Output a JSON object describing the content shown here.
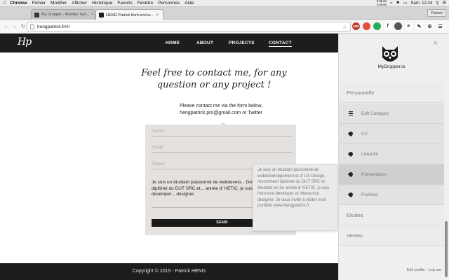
{
  "menubar": {
    "app": "Chrome",
    "items": [
      "Fichier",
      "Modifier",
      "Afficher",
      "Historique",
      "Favoris",
      "Fenêtre",
      "Personnes",
      "Aide"
    ],
    "net_up": "8.0Ko/s",
    "net_down": "0.5Ko/s",
    "clock": "Sam. 12:24"
  },
  "tabs": [
    {
      "title": "My Dropper - Modifier l'art..."
    },
    {
      "title": "HENG Patrick front-end w..."
    }
  ],
  "profile_label": "Patrick",
  "address": "hengpatrick.fr/#/",
  "site": {
    "logo": "Hp",
    "nav": [
      "HOME",
      "ABOUT",
      "PROJECTS",
      "CONTACT"
    ],
    "headline_line1": "Feel free to contact me, for any",
    "headline_line2": "question or any project !",
    "sub_line1": "Please contact me via the form below,",
    "sub_line2": "hengpatrick.pro@gmail.com or Twitter",
    "form": {
      "name_placeholder": "Name",
      "email_placeholder": "Email",
      "object_placeholder": "Object",
      "message": "Je suis un étudiant passionné de webdevelo... Design, récemment diplômé du DUT SRC et... année d' HETIC, je suis front-end developer... designer.",
      "send_label": "SEND"
    },
    "tooltip": "Je suis un étudiant passionné de webdéveloppement et d' UX Design, récemment diplômé du DUT SRC et étudiant en 3e année d' HETIC, je suis front-end developer et interactive designer. Je vous invite à visiter mon portfolio www.hengpatrick.fr",
    "footer": "Copyright © 2015 - Patrick HENG"
  },
  "panel": {
    "brand": "MyDropper.io",
    "section_personnelle": "Personnelle",
    "items": [
      {
        "label": "Edit Category",
        "icon": "list-icon"
      },
      {
        "label": "CV",
        "icon": "tag-icon"
      },
      {
        "label": "Linkedin",
        "icon": "tag-icon"
      },
      {
        "label": "Présentation",
        "icon": "tag-icon",
        "selected": true
      },
      {
        "label": "Portfolio",
        "icon": "tag-icon"
      }
    ],
    "section_etudes": "Etudes",
    "section_ventes": "Ventes",
    "footer": "Edit profile - Log out"
  },
  "colors": {
    "nav_bg": "#1d1d1d",
    "form_bg": "#e4e1df",
    "panel_bg": "#efefef",
    "panel_item_bg": "#e2e2e2",
    "panel_selected_bg": "#cfcfcf"
  }
}
